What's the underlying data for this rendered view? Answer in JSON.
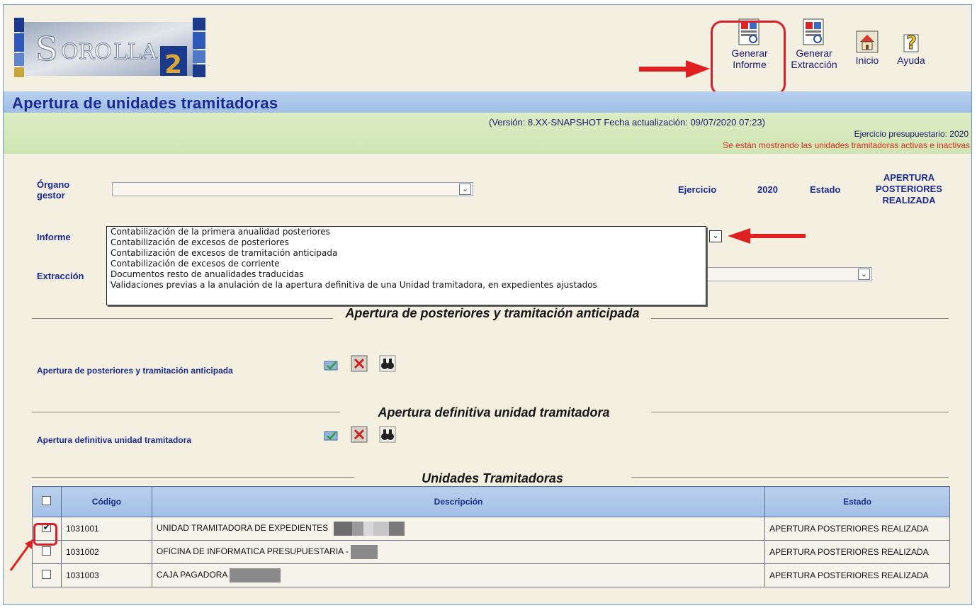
{
  "header": {
    "logo_text": "SOROLLA2",
    "buttons": [
      {
        "label": "Generar Informe",
        "icon": "report-icon"
      },
      {
        "label": "Generar Extracción",
        "icon": "extraction-icon"
      },
      {
        "label": "Inicio",
        "icon": "home-icon"
      },
      {
        "label": "Ayuda",
        "icon": "help-icon"
      }
    ]
  },
  "page": {
    "title": "Apertura de unidades tramitadoras",
    "version": "(Versión: 8.XX-SNAPSHOT Fecha actualización: 09/07/2020 07:23)",
    "ejercicio_presupuestario": "Ejercicio presupuestario: 2020",
    "warning": "Se están mostrando las unidades tramitadoras activas e inactivas"
  },
  "form": {
    "organo_label": "Órgano gestor",
    "organo_value": "",
    "ejercicio_label": "Ejercicio",
    "ejercicio_value": "2020",
    "estado_label": "Estado",
    "estado_value": "APERTURA POSTERIORES REALIZADA",
    "informe_label": "Informe",
    "extraccion_label": "Extracción",
    "informe_options": [
      "Contabilización de la primera anualidad posteriores",
      "Contabilización de excesos de posteriores",
      "Contabilización de excesos de tramitación anticipada",
      "Contabilización de excesos de corriente",
      "Documentos resto de anualidades traducidas",
      "Validaciones previas a la anulación de la apertura definitiva de una Unidad tramitadora, en expedientes ajustados"
    ]
  },
  "sections": {
    "posteriores": {
      "title": "Apertura de posteriores y tramitación anticipada",
      "action_label": "Apertura de posteriores y tramitación anticipada"
    },
    "definitiva": {
      "title": "Apertura definitiva unidad tramitadora",
      "action_label": "Apertura definitiva unidad tramitadora"
    },
    "unidades": {
      "title": "Unidades Tramitadoras"
    }
  },
  "table": {
    "headers": {
      "codigo": "Código",
      "descripcion": "Descripción",
      "estado": "Estado"
    },
    "rows": [
      {
        "checked": true,
        "codigo": "1031001",
        "descripcion": "UNIDAD TRAMITADORA DE EXPEDIENTES",
        "estado": "APERTURA POSTERIORES REALIZADA"
      },
      {
        "checked": false,
        "codigo": "1031002",
        "descripcion": "OFICINA DE INFORMATICA PRESUPUESTARIA -",
        "estado": "APERTURA POSTERIORES REALIZADA"
      },
      {
        "checked": false,
        "codigo": "1031003",
        "descripcion": "CAJA PAGADORA",
        "estado": "APERTURA POSTERIORES REALIZADA"
      }
    ]
  },
  "colors": {
    "title_blue": "#1b2a8f",
    "highlight_red": "#d81f2a",
    "warning_red": "#e0281e",
    "title_bar": "#b7cfee",
    "green_bar": "#dcecc4",
    "background": "#f3efe1"
  }
}
